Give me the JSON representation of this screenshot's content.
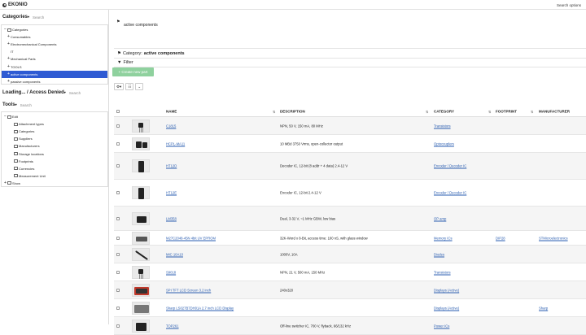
{
  "topbar": {
    "brand": "EKONIO",
    "search_options": "Search options"
  },
  "sidebar": {
    "categories": {
      "title": "Categories",
      "search": "Search",
      "items": [
        {
          "toggle": "−",
          "icon": "folder-icon",
          "label": "Categories",
          "indent": 0,
          "active": false
        },
        {
          "toggle": "+",
          "icon": "",
          "label": "Consumables",
          "indent": 1,
          "active": false
        },
        {
          "toggle": "+",
          "icon": "",
          "label": "Electromechanical Components",
          "indent": 1,
          "active": false
        },
        {
          "toggle": "",
          "icon": "",
          "label": "IT",
          "indent": 1,
          "active": false
        },
        {
          "toggle": "+",
          "icon": "",
          "label": "Mechanical Parts",
          "indent": 1,
          "active": false
        },
        {
          "toggle": "+",
          "icon": "",
          "label": "TOOLS",
          "indent": 1,
          "active": false
        },
        {
          "toggle": "+",
          "icon": "",
          "label": "active components",
          "indent": 1,
          "active": true
        },
        {
          "toggle": "+",
          "icon": "",
          "label": "passive components",
          "indent": 1,
          "active": false
        }
      ]
    },
    "loading": {
      "title": "Loading... / Access Denied",
      "search": "Search"
    },
    "tools": {
      "title": "Tools",
      "search": "Search",
      "items": [
        {
          "toggle": "−",
          "icon": "folder-icon",
          "label": "Edit",
          "indent": 0
        },
        {
          "toggle": "",
          "icon": "file-icon",
          "label": "Attachment types",
          "indent": 2
        },
        {
          "toggle": "",
          "icon": "file-icon",
          "label": "Categories",
          "indent": 2
        },
        {
          "toggle": "",
          "icon": "file-icon",
          "label": "Suppliers",
          "indent": 2
        },
        {
          "toggle": "",
          "icon": "file-icon",
          "label": "Manufacturers",
          "indent": 2
        },
        {
          "toggle": "",
          "icon": "file-icon",
          "label": "Storage locations",
          "indent": 2
        },
        {
          "toggle": "",
          "icon": "file-icon",
          "label": "Footprints",
          "indent": 2
        },
        {
          "toggle": "",
          "icon": "file-icon",
          "label": "Currencies",
          "indent": 2
        },
        {
          "toggle": "",
          "icon": "file-icon",
          "label": "Measurement Unit",
          "indent": 2
        },
        {
          "toggle": "+",
          "icon": "eye-icon",
          "label": "Show",
          "indent": 0
        }
      ]
    }
  },
  "main": {
    "title_name": "active components",
    "category_prefix": "Category:",
    "category_name": "active components",
    "filter_label": "Filter",
    "create_button": "Create new part",
    "columns": [
      "NAME",
      "DESCRIPTION",
      "CATEGORY",
      "FOOTPRINT",
      "MANUFACTURER"
    ],
    "rows": [
      {
        "name": "C1815",
        "description": "NPN, 50 V, 150 mA, 80 MHz",
        "category": "Transistors",
        "footprint": "",
        "manufacturer": "",
        "thumb": "to92"
      },
      {
        "name": "HCPL-MA11",
        "description": "10 MBd 3750 Vrms, open-collector output",
        "category": "Optocouplers",
        "footprint": "",
        "manufacturer": "",
        "thumb": "dip"
      },
      {
        "name": "HT12D",
        "description": "Decoder IC, 12-bit (8 addr + 4 data) 2.4-12 V",
        "category": "Encoder / Decoder IC",
        "footprint": "",
        "manufacturer": "",
        "thumb": "dip18"
      },
      {
        "name": "HT12E",
        "description": "Encoder IC, 12-bit 2.4-12 V",
        "category": "Encoder / Decoder IC",
        "footprint": "",
        "manufacturer": "",
        "thumb": "dip18"
      },
      {
        "name": "LM358",
        "description": "Dual, 3-32 V, ~1 MHz GBW, low bias",
        "category": "OP amp",
        "footprint": "",
        "manufacturer": "",
        "thumb": "soic"
      },
      {
        "name": "M27C2048-45N 4bit UV EPROM",
        "description": "32K-Word x 8-Bit, access time: 100 nS, with glass window",
        "category": "Memory ICs",
        "footprint": "DIP28",
        "manufacturer": "STMicroelectronics",
        "thumb": "chip"
      },
      {
        "name": "MIC 10A10",
        "description": "1000V, 10A",
        "category": "Diodes",
        "footprint": "",
        "manufacturer": "",
        "thumb": "diode"
      },
      {
        "name": "S9018",
        "description": "NPN, 21 V, 500 mA, 150 MHz",
        "category": "Transistors",
        "footprint": "",
        "manufacturer": "",
        "thumb": "to92"
      },
      {
        "name": "SPI TFT LCD Screen 3.2 inch",
        "description": "240x320",
        "category": "Displays (Active)",
        "footprint": "",
        "manufacturer": "",
        "thumb": "lcd"
      },
      {
        "name": "Sharp LS027B7DH01A 2.7 inch LCD Display",
        "description": "",
        "category": "Displays (Active)",
        "footprint": "",
        "manufacturer": "Sharp",
        "thumb": "lcd2"
      },
      {
        "name": "TOP261",
        "description": "Off-line switcher IC, 700 V, flyback, 66/132 kHz",
        "category": "Power ICs",
        "footprint": "",
        "manufacturer": "",
        "thumb": "chip2"
      }
    ]
  }
}
